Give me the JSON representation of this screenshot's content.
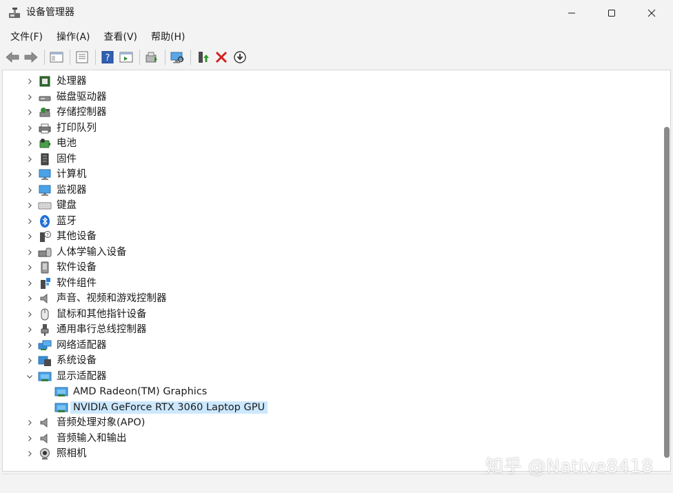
{
  "window": {
    "title": "设备管理器",
    "icon": "device-manager-icon"
  },
  "menu": [
    "文件(F)",
    "操作(A)",
    "查看(V)",
    "帮助(H)"
  ],
  "toolbar": {
    "buttons": [
      "back-arrow-icon",
      "forward-arrow-icon",
      "show-hide-tree-icon",
      "properties-icon",
      "help-icon",
      "action-pane-icon",
      "update-driver-icon",
      "scan-hardware-icon",
      "enable-device-icon",
      "uninstall-device-icon",
      "disable-device-icon"
    ]
  },
  "tree": [
    {
      "label": "处理器",
      "icon": "processor-icon",
      "expanded": false
    },
    {
      "label": "磁盘驱动器",
      "icon": "disk-drive-icon",
      "expanded": false
    },
    {
      "label": "存储控制器",
      "icon": "storage-controller-icon",
      "expanded": false
    },
    {
      "label": "打印队列",
      "icon": "printer-icon",
      "expanded": false
    },
    {
      "label": "电池",
      "icon": "battery-icon",
      "expanded": false
    },
    {
      "label": "固件",
      "icon": "firmware-icon",
      "expanded": false
    },
    {
      "label": "计算机",
      "icon": "computer-icon",
      "expanded": false
    },
    {
      "label": "监视器",
      "icon": "monitor-icon",
      "expanded": false
    },
    {
      "label": "键盘",
      "icon": "keyboard-icon",
      "expanded": false
    },
    {
      "label": "蓝牙",
      "icon": "bluetooth-icon",
      "expanded": false
    },
    {
      "label": "其他设备",
      "icon": "other-devices-icon",
      "expanded": false
    },
    {
      "label": "人体学输入设备",
      "icon": "hid-icon",
      "expanded": false
    },
    {
      "label": "软件设备",
      "icon": "software-device-icon",
      "expanded": false
    },
    {
      "label": "软件组件",
      "icon": "software-component-icon",
      "expanded": false
    },
    {
      "label": "声音、视频和游戏控制器",
      "icon": "speaker-icon",
      "expanded": false
    },
    {
      "label": "鼠标和其他指针设备",
      "icon": "mouse-icon",
      "expanded": false
    },
    {
      "label": "通用串行总线控制器",
      "icon": "usb-icon",
      "expanded": false
    },
    {
      "label": "网络适配器",
      "icon": "network-adapter-icon",
      "expanded": false
    },
    {
      "label": "系统设备",
      "icon": "system-device-icon",
      "expanded": false
    },
    {
      "label": "显示适配器",
      "icon": "display-adapter-icon",
      "expanded": true
    },
    {
      "label": "AMD Radeon(TM) Graphics",
      "icon": "display-adapter-icon",
      "child": true
    },
    {
      "label": "NVIDIA GeForce RTX 3060 Laptop GPU",
      "icon": "display-adapter-icon",
      "child": true,
      "selected": true
    },
    {
      "label": "音频处理对象(APO)",
      "icon": "speaker-icon",
      "expanded": false
    },
    {
      "label": "音频输入和输出",
      "icon": "speaker-icon",
      "expanded": false
    },
    {
      "label": "照相机",
      "icon": "camera-icon",
      "expanded": false
    }
  ],
  "watermark": "知乎 @Native8418",
  "colors": {
    "selection": "#cce8ff",
    "window_bg": "#f3f3f3",
    "panel_bg": "#ffffff"
  }
}
